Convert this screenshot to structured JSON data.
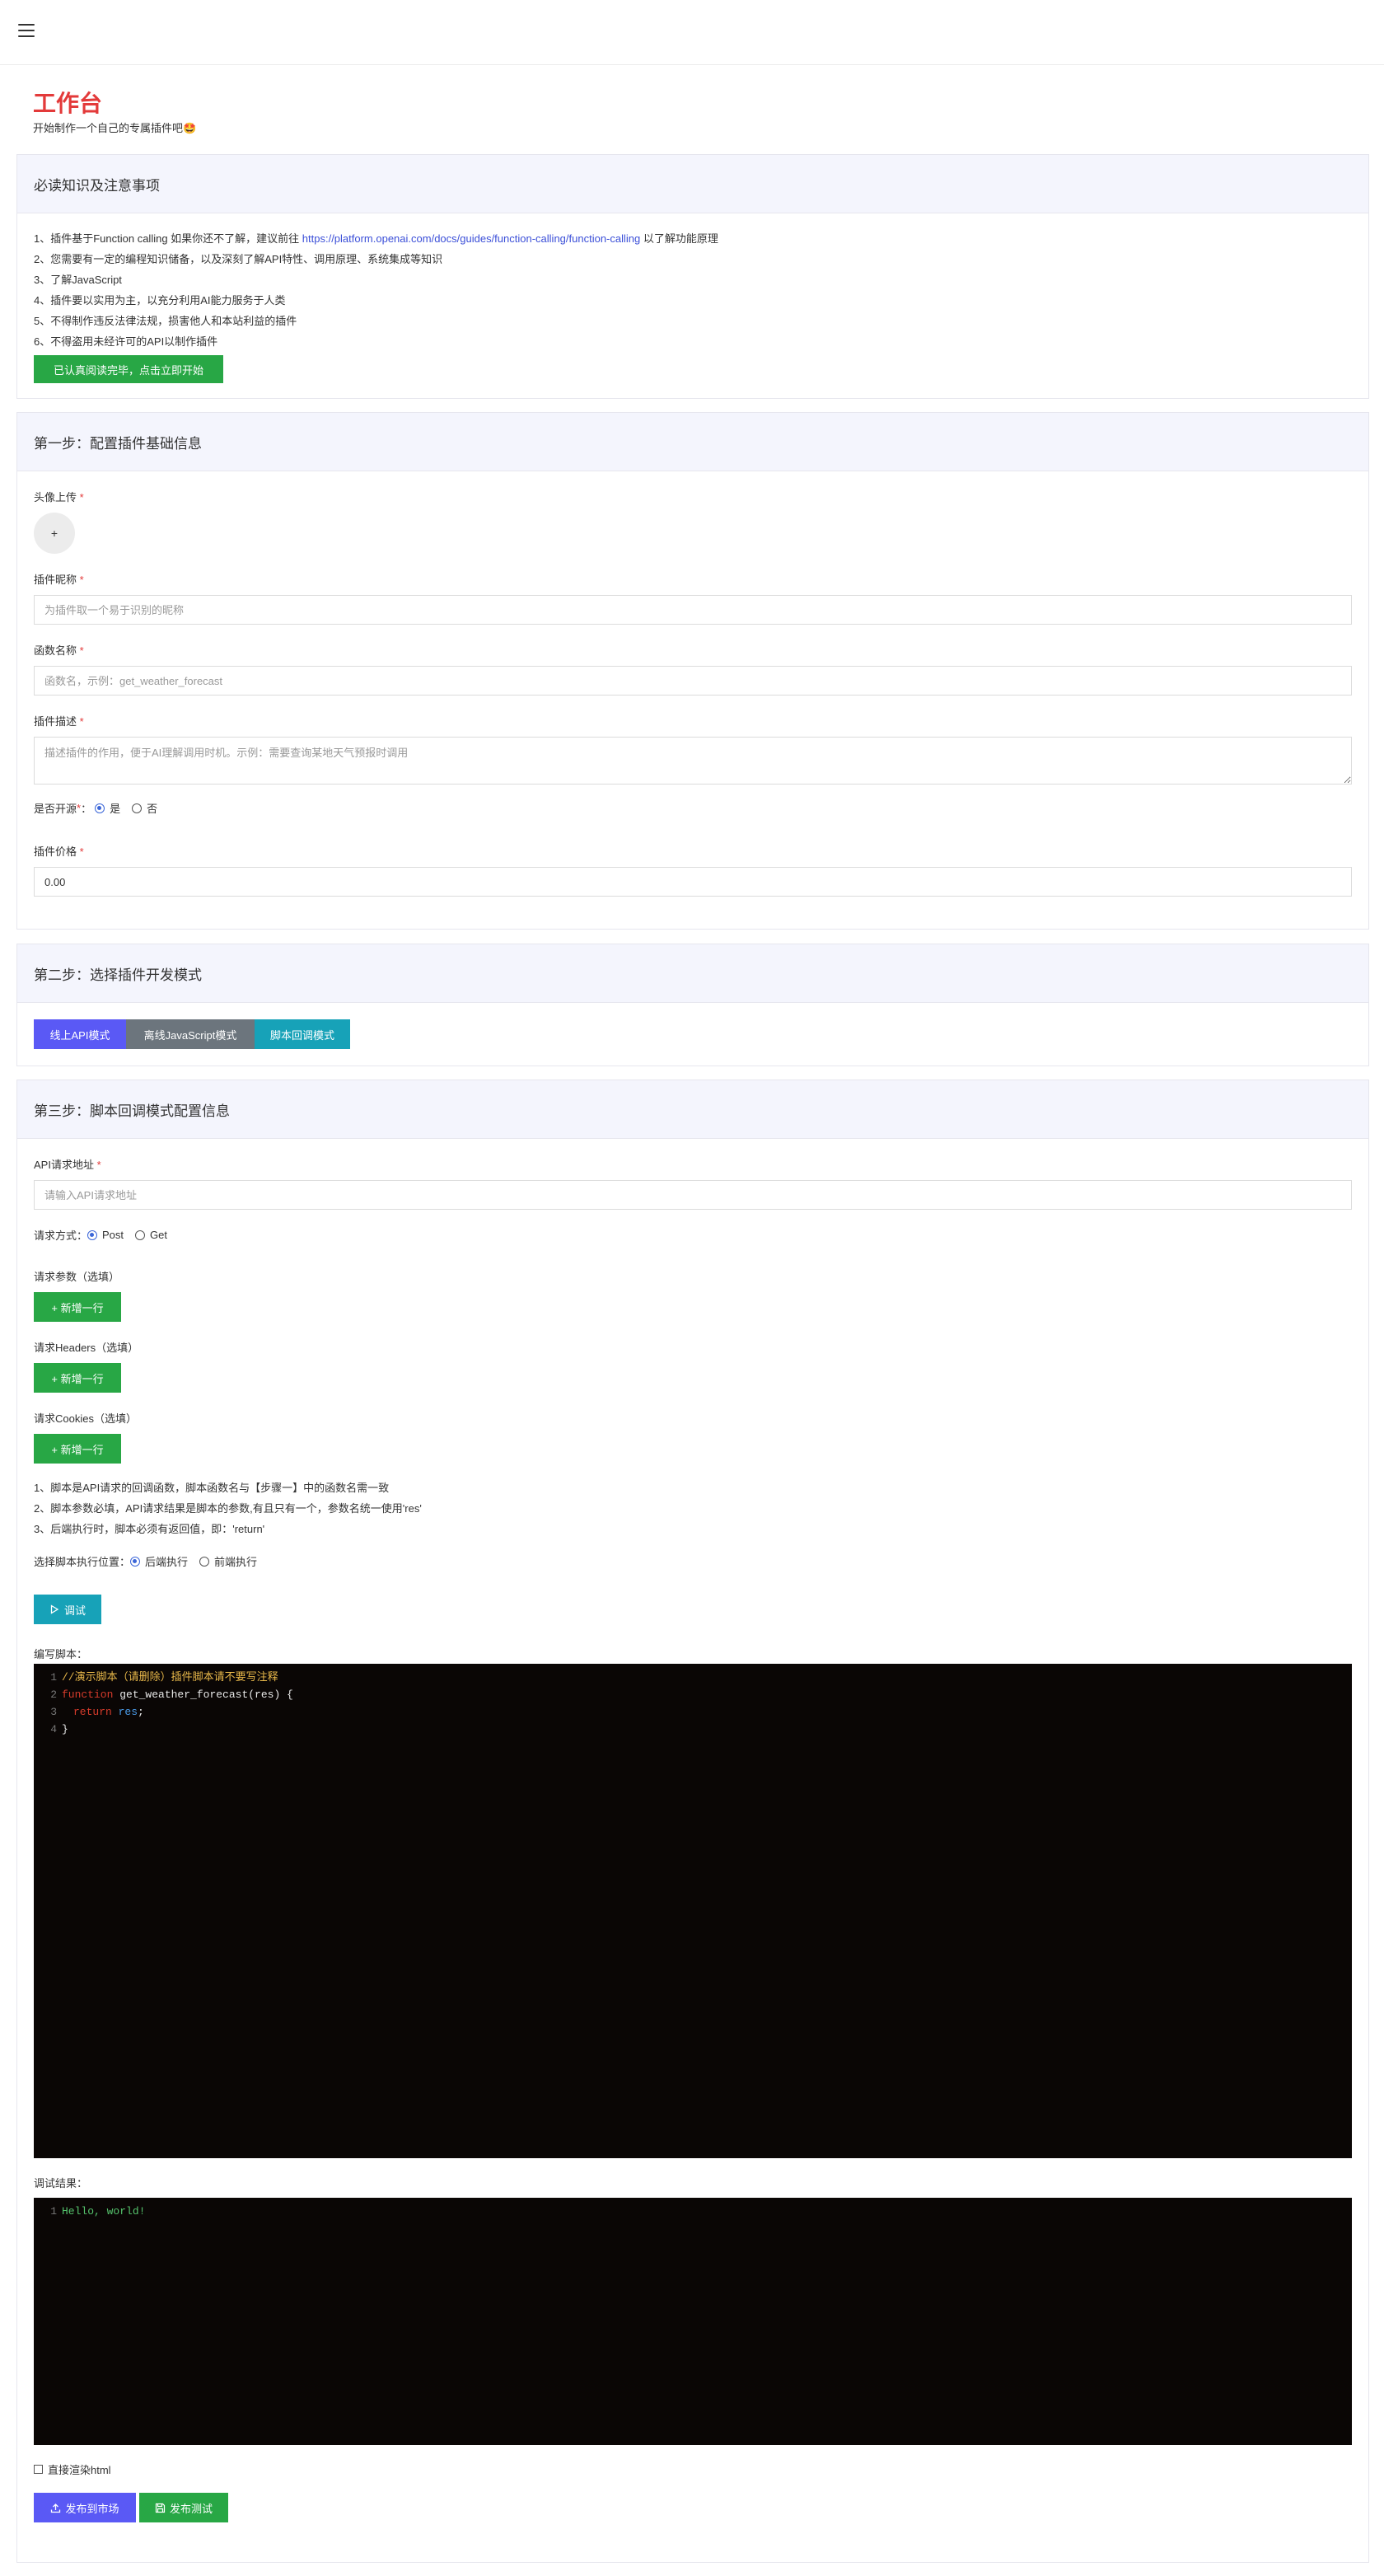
{
  "header": {
    "title": "工作台",
    "subtitle": "开始制作一个自己的专属插件吧",
    "emoji": "🤩"
  },
  "notice": {
    "title": "必读知识及注意事项",
    "line1_prefix": "1、插件基于Function calling 如果你还不了解，建议前往 ",
    "line1_link": "https://platform.openai.com/docs/guides/function-calling/function-calling",
    "line1_suffix": " 以了解功能原理",
    "lines": [
      "2、您需要有一定的编程知识储备，以及深刻了解API特性、调用原理、系统集成等知识",
      "3、了解JavaScript",
      "4、插件要以实用为主，以充分利用AI能力服务于人类",
      "5、不得制作违反法律法规，损害他人和本站利益的插件",
      "6、不得盗用未经许可的API以制作插件"
    ],
    "start_button": "已认真阅读完毕，点击立即开始"
  },
  "step1": {
    "title": "第一步：配置插件基础信息",
    "avatar_label": "头像上传",
    "avatar_plus": "+",
    "name_label": "插件昵称",
    "name_placeholder": "为插件取一个易于识别的昵称",
    "func_label": "函数名称",
    "func_placeholder": "函数名，示例：get_weather_forecast",
    "desc_label": "插件描述",
    "desc_placeholder": "描述插件的作用，便于AI理解调用时机。示例：需要查询某地天气预报时调用",
    "open_label": "是否开源",
    "open_yes": "是",
    "open_no": "否",
    "price_label": "插件价格",
    "price_value": "0.00"
  },
  "step2": {
    "title": "第二步：选择插件开发模式",
    "modes": [
      "线上API模式",
      "离线JavaScript模式",
      "脚本回调模式"
    ]
  },
  "step3": {
    "title": "第三步：脚本回调模式配置信息",
    "api_label": "API请求地址",
    "api_placeholder": "请输入API请求地址",
    "method_label": "请求方式：",
    "method_post": "Post",
    "method_get": "Get",
    "params_label": "请求参数（选填）",
    "headers_label": "请求Headers（选填）",
    "cookies_label": "请求Cookies（选填）",
    "add_row": "+ 新增一行",
    "tips": [
      "1、脚本是API请求的回调函数，脚本函数名与【步骤一】中的函数名需一致",
      "2、脚本参数必填，API请求结果是脚本的参数,有且只有一个，参数名统一使用'res'",
      "3、后端执行时，脚本必须有返回值，即：'return'"
    ],
    "exec_label": "选择脚本执行位置：",
    "exec_backend": "后端执行",
    "exec_frontend": "前端执行",
    "debug_button": "调试",
    "script_label": "编写脚本：",
    "code": {
      "l1": "//演示脚本（请删除）插件脚本请不要写注释",
      "l2_kw": "function",
      "l2_rest": " get_weather_forecast(res) {",
      "l3_kw": "return",
      "l3_var": " res",
      "l3_end": ";",
      "l4": "}"
    },
    "result_label": "调试结果：",
    "result_line": "Hello, world!",
    "render_html": "直接渲染html",
    "publish_market": "发布到市场",
    "publish_test": "发布测试"
  },
  "icons": {
    "menu": "hamburger-icon",
    "debug": "play-icon",
    "upload": "upload-icon",
    "save": "save-icon"
  }
}
